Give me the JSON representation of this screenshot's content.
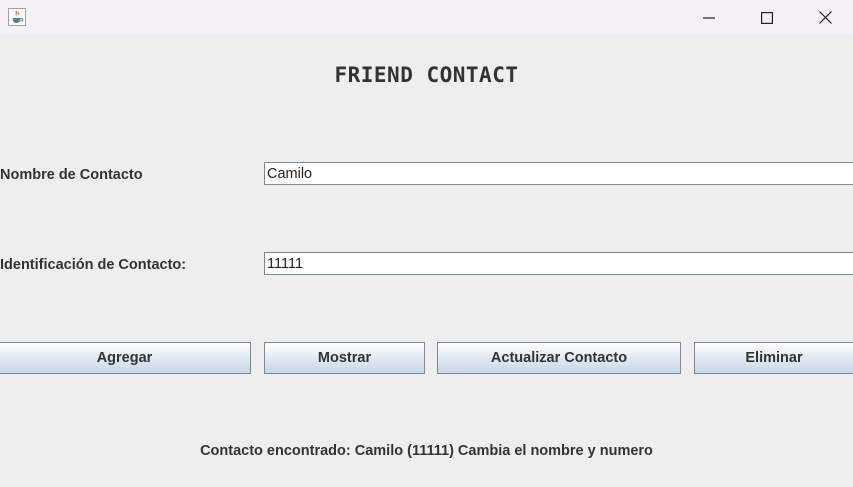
{
  "window": {
    "icon": "java-cup-icon",
    "controls": [
      "minimize-icon",
      "maximize-icon",
      "close-icon"
    ]
  },
  "main": {
    "heading": "FRIEND CONTACT",
    "name_label": "Nombre de Contacto",
    "name_value": "Camilo",
    "id_label": "Identificación de Contacto:",
    "id_value": "11111",
    "buttons": {
      "add": "Agregar",
      "show": "Mostrar",
      "update": "Actualizar Contacto",
      "delete": "Eliminar"
    },
    "status": "Contacto encontrado: Camilo (11111) Cambia el nombre y numero"
  }
}
